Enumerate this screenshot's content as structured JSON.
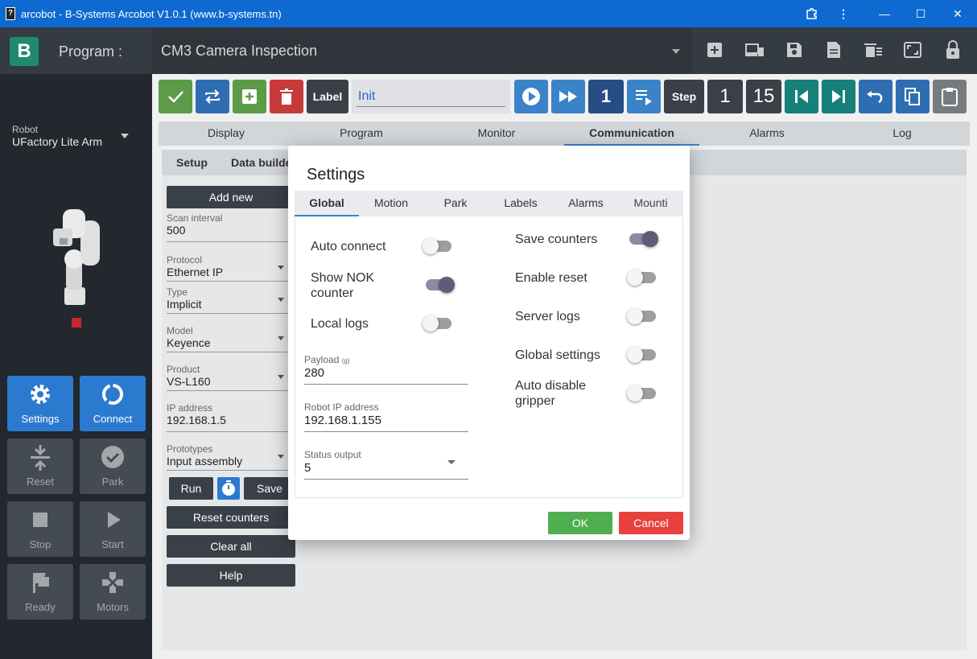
{
  "window": {
    "title": "arcobot - B-Systems Arcobot V1.0.1 (www.b-systems.tn)",
    "minimize": "—",
    "maximize": "☐",
    "close": "✕"
  },
  "appbar": {
    "program_label": "Program :",
    "program_name": "CM3 Camera Inspection"
  },
  "sidebar": {
    "robot_label": "Robot",
    "robot_name": "UFactory Lite Arm",
    "tiles": {
      "settings": "Settings",
      "connect": "Connect",
      "reset": "Reset",
      "park": "Park",
      "stop": "Stop",
      "start": "Start",
      "ready": "Ready",
      "motors": "Motors"
    }
  },
  "toolbar": {
    "label_btn": "Label",
    "label_value": "Init",
    "count_a": "1",
    "step": "Step",
    "step_value": "1",
    "total": "15"
  },
  "main_tabs": [
    "Display",
    "Program",
    "Monitor",
    "Communication",
    "Alarms",
    "Log"
  ],
  "sub_tabs": {
    "setup": "Setup",
    "data_builder": "Data builde"
  },
  "comm": {
    "add_new": "Add new",
    "scan_interval_label": "Scan interval",
    "scan_interval": "500",
    "protocol_label": "Protocol",
    "protocol": "Ethernet IP",
    "type_label": "Type",
    "type": "Implicit",
    "model_label": "Model",
    "model": "Keyence",
    "product_label": "Product",
    "product": "VS-L160",
    "ip_label": "IP address",
    "ip": "192.168.1.5",
    "prototypes_label": "Prototypes",
    "prototypes": "Input assembly",
    "run": "Run",
    "save": "Save",
    "reset_counters": "Reset counters",
    "clear_all": "Clear all",
    "help": "Help"
  },
  "dialog": {
    "title": "Settings",
    "tabs": [
      "Global",
      "Motion",
      "Park",
      "Labels",
      "Alarms",
      "Mounti"
    ],
    "left_switches": [
      {
        "label": "Auto connect",
        "on": false
      },
      {
        "label": "Show NOK counter",
        "on": true
      },
      {
        "label": "Local logs",
        "on": false
      }
    ],
    "right_switches": [
      {
        "label": "Save counters",
        "on": true
      },
      {
        "label": "Enable reset",
        "on": false
      },
      {
        "label": "Server logs",
        "on": false
      },
      {
        "label": "Global settings",
        "on": false
      },
      {
        "label": "Auto disable gripper",
        "on": false
      }
    ],
    "payload_label": "Payload",
    "payload_unit": "(g)",
    "payload": "280",
    "robot_ip_label": "Robot IP address",
    "robot_ip": "192.168.1.155",
    "status_output_label": "Status output",
    "status_output": "5",
    "ok": "OK",
    "cancel": "Cancel"
  }
}
